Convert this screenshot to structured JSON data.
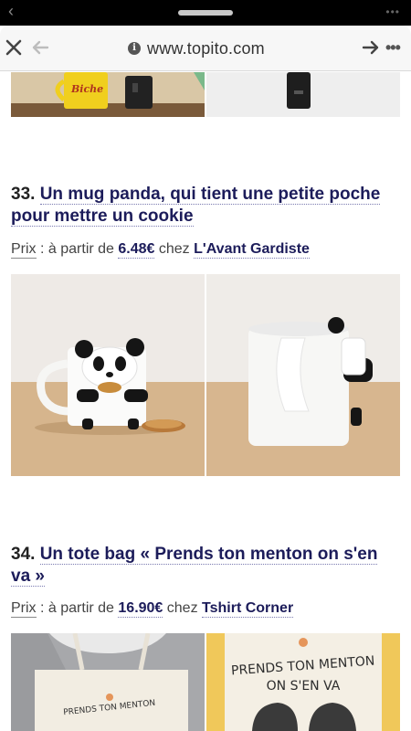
{
  "browser": {
    "url": "www.topito.com",
    "info_icon": "info-icon",
    "more_glyph": "•••"
  },
  "items": [
    {
      "number": "33.",
      "title": "Un mug panda, qui tient une petite poche pour mettre un cookie",
      "price_label": "Prix",
      "price_prefix": " : à partir de ",
      "price": "6.48€",
      "shop_prefix": " chez ",
      "shop": "L'Avant Gardiste"
    },
    {
      "number": "34.",
      "title": "Un tote bag « Prends ton menton on s'en va »",
      "price_label": "Prix",
      "price_prefix": " : à partir de ",
      "price": "16.90€",
      "shop_prefix": " chez ",
      "shop": "Tshirt Corner"
    }
  ],
  "images": {
    "mug_text": "Biche",
    "tote_text_line1": "PRENDS TON MENTON",
    "tote_text_line2": "ON S'EN VA",
    "tote_small_text": "PRENDS TON MENTON"
  }
}
